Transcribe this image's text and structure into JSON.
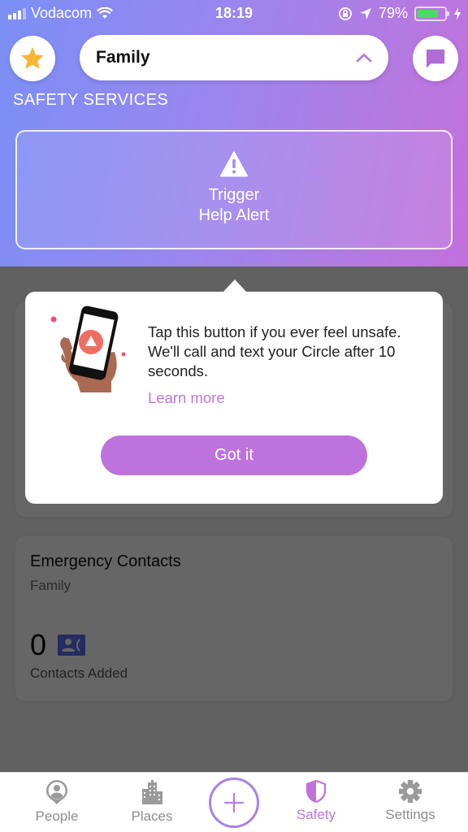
{
  "status_bar": {
    "carrier": "Vodacom",
    "time": "18:19",
    "battery_percent": "79%",
    "battery_level": 0.79,
    "icons": [
      "signal-icon",
      "wifi-icon",
      "rotation-lock-icon",
      "location-arrow-icon",
      "battery-icon",
      "charging-bolt-icon"
    ]
  },
  "header": {
    "circle_name": "Family",
    "section_title": "SAFETY SERVICES",
    "help_alert_line1": "Trigger",
    "help_alert_line2": "Help Alert",
    "colors": {
      "gradient_start": "#7b8ff5",
      "gradient_end": "#c270dc",
      "star": "#f7b538",
      "accent": "#be73dc"
    }
  },
  "tooltip": {
    "message": "Tap this button if you ever feel unsafe. We'll call and text your Circle after 10 seconds.",
    "learn_more": "Learn more",
    "button": "Got it"
  },
  "emergency_card": {
    "title": "Emergency Contacts",
    "subtitle": "Family",
    "count": "0",
    "count_label": "Contacts Added"
  },
  "tabbar": {
    "items": [
      {
        "label": "People",
        "icon": "person-pin-icon",
        "active": false
      },
      {
        "label": "Places",
        "icon": "buildings-icon",
        "active": false
      },
      {
        "label": "Safety",
        "icon": "shield-icon",
        "active": true
      },
      {
        "label": "Settings",
        "icon": "gear-icon",
        "active": false
      }
    ],
    "add_icon": "plus-icon"
  }
}
